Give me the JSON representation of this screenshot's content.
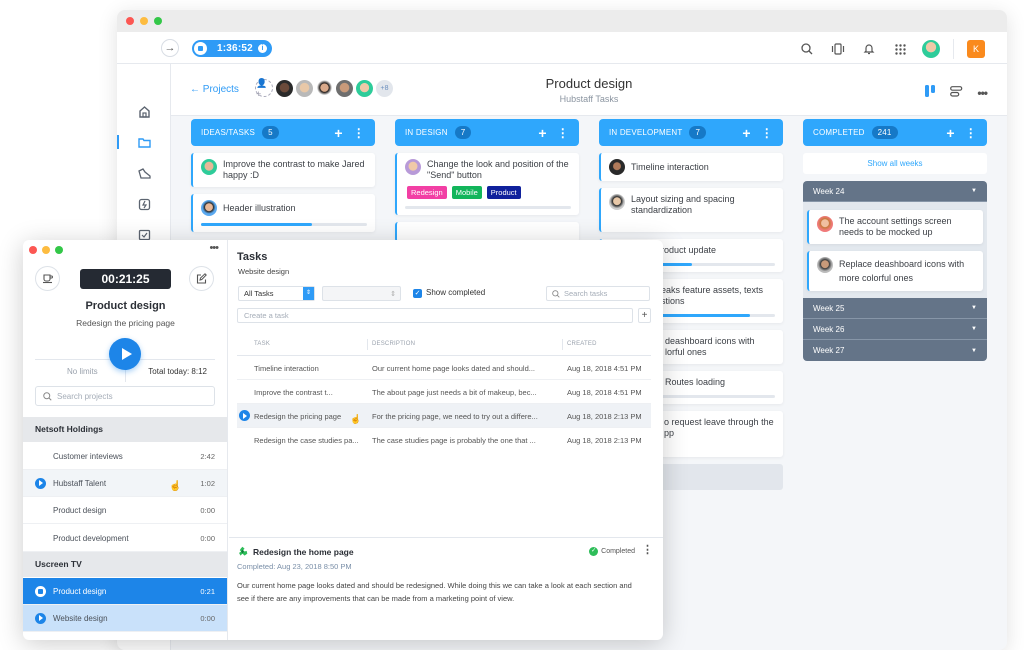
{
  "main_window": {
    "timer": "1:36:52",
    "sidebar": [
      {
        "icon": "home-icon",
        "active": false
      },
      {
        "icon": "folder-icon",
        "active": true
      },
      {
        "icon": "sneaker-icon",
        "active": false
      },
      {
        "icon": "lightning-box-icon",
        "active": false
      },
      {
        "icon": "checkbox-icon",
        "active": false
      }
    ],
    "top_icons": [
      "search-icon",
      "vibrate-icon",
      "bell-icon",
      "apps-grid-icon"
    ],
    "user_badge": "K",
    "back_label": "Projects",
    "more_members": "+8",
    "project_title": "Product design",
    "project_subtitle": "Hubstaff Tasks"
  },
  "board": {
    "columns": [
      {
        "title": "IDEAS/TASKS",
        "count": "5",
        "cards": [
          {
            "text": "Improve the contrast to make Jared happy :D"
          },
          {
            "text": "Header illustration",
            "progress": 0.67
          }
        ]
      },
      {
        "title": "IN DESIGN",
        "count": "7",
        "cards": [
          {
            "text": "Change the look and position of the \"Send\" button",
            "tags": [
              {
                "label": "Redesign",
                "color": "#f23fa4"
              },
              {
                "label": "Mobile",
                "color": "#12b55b"
              },
              {
                "label": "Product",
                "color": "#0f219c"
              }
            ],
            "progress": 0
          }
        ]
      },
      {
        "title": "IN DEVELOPMENT",
        "count": "7",
        "cards": [
          {
            "text": "Timeline interaction"
          },
          {
            "text": "Layout sizing and spacing standardization"
          },
          {
            "text": "roduct update",
            "progress": 0.5
          },
          {
            "text": "eaks feature assets, texts stions",
            "progress": 0.85
          },
          {
            "text": "deashboard icons with lorful ones"
          },
          {
            "text": "Routes loading",
            "progress": 0.2
          },
          {
            "text": "o request leave through the pp"
          }
        ]
      },
      {
        "title": "COMPLETED",
        "count": "241",
        "show_all": "Show all weeks",
        "weeks": [
          {
            "label": "Week 24",
            "cards": [
              {
                "text": "The account settings screen needs to be mocked up"
              },
              {
                "text": "Replace deashboard icons with more colorful ones"
              }
            ]
          },
          {
            "label": "Week 25"
          },
          {
            "label": "Week 26"
          },
          {
            "label": "Week 27"
          }
        ]
      }
    ]
  },
  "tracker": {
    "timer": "00:21:25",
    "project": "Product design",
    "task": "Redesign the pricing page",
    "limits": "No limits",
    "total_today": "Total today: 8:12",
    "search_placeholder": "Search projects",
    "groups": [
      {
        "name": "Netsoft Holdings",
        "items": [
          {
            "name": "Customer inteviews",
            "time": "2:42",
            "state": ""
          },
          {
            "name": "Hubstaff Talent",
            "time": "1:02",
            "state": "hover"
          },
          {
            "name": "Product design",
            "time": "0:00",
            "state": ""
          },
          {
            "name": "Product development",
            "time": "0:00",
            "state": ""
          }
        ]
      },
      {
        "name": "Uscreen TV",
        "items": [
          {
            "name": "Product design",
            "time": "0:21",
            "state": "active"
          },
          {
            "name": "Website design",
            "time": "0:00",
            "state": "light"
          }
        ]
      }
    ],
    "tasks_panel": {
      "title": "Tasks",
      "subtitle": "Website design",
      "filter": "All Tasks",
      "show_completed": "Show completed",
      "search_placeholder": "Search tasks",
      "create_placeholder": "Create a task",
      "headers": [
        "TASK",
        "DESCRIPTION",
        "CREATED"
      ],
      "rows": [
        {
          "task": "Timeline interaction",
          "desc": "Our current home page looks dated and should...",
          "created": "Aug 18, 2018 4:51 PM"
        },
        {
          "task": "Improve the contrast t...",
          "desc": "The about page just needs a bit of makeup, bec...",
          "created": "Aug 18, 2018 4:51 PM"
        },
        {
          "task": "Redesign the pricing page",
          "desc": "For the pricing page, we need to try out a differe...",
          "created": "Aug 18, 2018 2:13 PM",
          "active": true
        },
        {
          "task": "Redesign the case studies pa...",
          "desc": "The case studies page is probably the one that ...",
          "created": "Aug 18, 2018 2:13 PM"
        }
      ],
      "detail": {
        "title": "Redesign the home page",
        "status": "Completed",
        "date": "Completed: Aug 23, 2018 8:50 PM",
        "description": "Our current home page looks dated and should be redesigned. While doing this we can take a look at each section and see if there are any improvements that can be made from a marketing point of view."
      }
    }
  }
}
